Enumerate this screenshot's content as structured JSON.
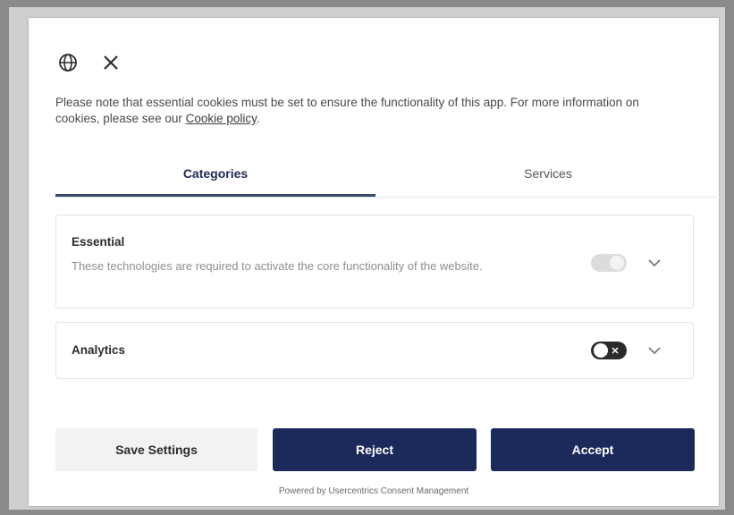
{
  "header": {
    "language_icon": "globe-icon",
    "close_icon": "close-icon"
  },
  "notice": {
    "text": "Please note that essential cookies must be set to ensure the functionality of this app. For more information on cookies, please see our ",
    "link_text": "Cookie policy",
    "after_link": "."
  },
  "tabs": [
    {
      "label": "Categories",
      "active": true
    },
    {
      "label": "Services",
      "active": false
    }
  ],
  "categories": {
    "essential": {
      "title": "Essential",
      "description": "These technologies are required to activate the core functionality of the website.",
      "toggle_state": "on-disabled"
    },
    "analytics": {
      "title": "Analytics",
      "toggle_state": "off"
    }
  },
  "buttons": {
    "save": "Save Settings",
    "reject": "Reject",
    "accept": "Accept"
  },
  "footer": "Powered by Usercentrics Consent Management",
  "colors": {
    "primary": "#1b2a5a",
    "tab_underline": "#3c4a72",
    "secondary_button": "#f2f2f2"
  }
}
